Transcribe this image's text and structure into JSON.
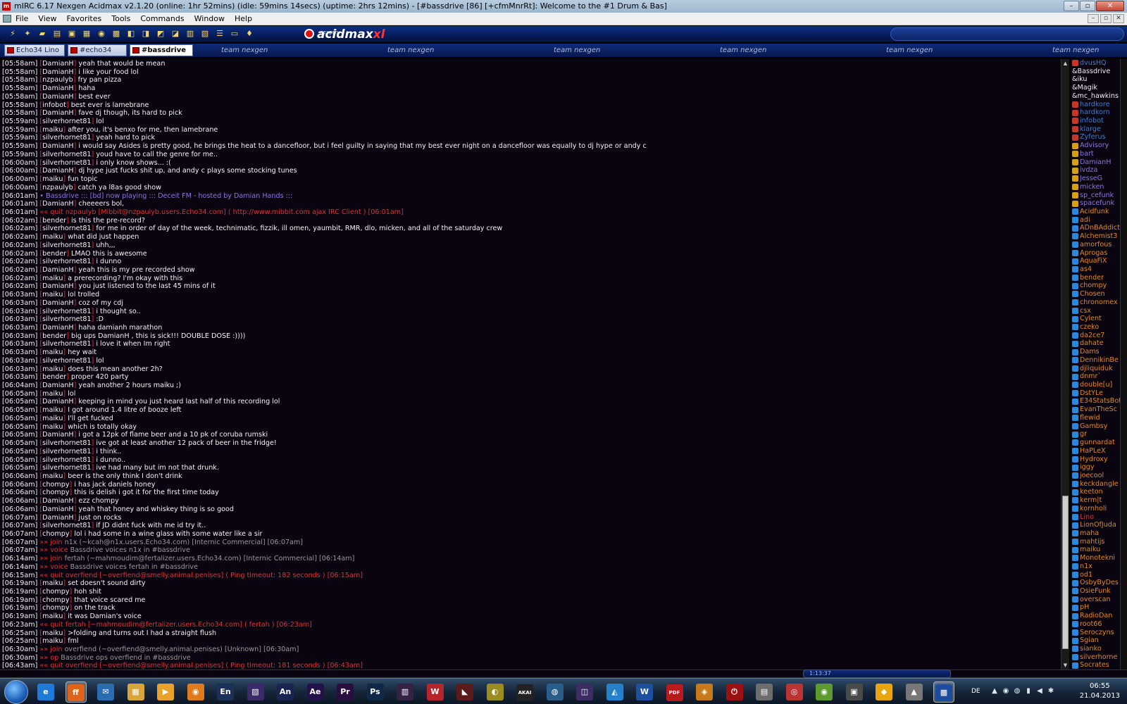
{
  "window": {
    "title": "mIRC 6.17 Nexgen Acidmax v2.1.20 (online: 1hr 52mins) (idle: 59mins 14secs) (uptime: 2hrs 12mins) - [#bassdrive [86] [+cfmMnrRt]: Welcome to the #1 Drum & Bas]",
    "controls": [
      "–",
      "▫",
      "✕"
    ]
  },
  "menu": [
    "File",
    "View",
    "Favorites",
    "Tools",
    "Commands",
    "Window",
    "Help"
  ],
  "mdi_controls": [
    "–",
    "▫",
    "✕"
  ],
  "toolbar": {
    "logo_small": "nexgen",
    "logo_main": "acidmax",
    "logo_suffix": "xl"
  },
  "switchbar": {
    "tabs": [
      "Echo34 Lino",
      "#echo34",
      "#bassdrive"
    ],
    "banner": "team nexgen"
  },
  "chat": [
    [
      "[05:58am]",
      "DamianH",
      "yeah that would be mean",
      "m"
    ],
    [
      "[05:58am]",
      "DamianH",
      "i like your food lol",
      "m"
    ],
    [
      "[05:58am]",
      "nzpaulyb",
      "fry pan pizza",
      "m"
    ],
    [
      "[05:58am]",
      "DamianH",
      "haha",
      "m"
    ],
    [
      "[05:58am]",
      "DamianH",
      "best ever",
      "m"
    ],
    [
      "[05:58am]",
      "infobot",
      "best ever is lamebrane",
      "m"
    ],
    [
      "[05:58am]",
      "DamianH",
      "fave dj though, its hard to pick",
      "m"
    ],
    [
      "[05:59am]",
      "silverhornet81",
      "lol",
      "m"
    ],
    [
      "[05:59am]",
      "maiku",
      "after you, it's benxo for me, then lamebrane",
      "m"
    ],
    [
      "[05:59am]",
      "silverhornet81",
      "yeah hard to pick",
      "m"
    ],
    [
      "[05:59am]",
      "DamianH",
      "i would say Asides is pretty good, he brings the heat to a dancefloor, but i feel guilty in saying that my best ever night on a dancefloor was equally to dj hype or andy c",
      "m"
    ],
    [
      "[05:59am]",
      "silverhornet81",
      "youd have to call the genre for me..",
      "m"
    ],
    [
      "[06:00am]",
      "silverhornet81",
      "i only know shows... :(",
      "m"
    ],
    [
      "[06:00am]",
      "DamianH",
      "dj hype just fucks shit up, and andy c plays some stocking tunes",
      "m"
    ],
    [
      "[06:00am]",
      "maiku",
      "fun topic",
      "m"
    ],
    [
      "[06:00am]",
      "nzpaulyb",
      "catch ya l8as good show",
      "m"
    ],
    [
      "[06:01am]",
      "",
      "• Bassdrive ::: [bd] now playing ::: Deceit FM - hosted by Damian Hands :::",
      "np"
    ],
    [
      "[06:01am]",
      "DamianH",
      "cheeeers bol,",
      "m"
    ],
    [
      "[06:01am]",
      "«« quit",
      "nzpaulyb [Mibbit@nzpaulyb.users.Echo34.com] ( http://www.mibbit.com ajax IRC Client )  [06:01am]",
      "quit"
    ],
    [
      "[06:02am]",
      "bender",
      "is this the pre-record?",
      "m"
    ],
    [
      "[06:02am]",
      "silverhornet81",
      "for me in order of day of the week, technimatic, fizzik, ill omen, yaumbit, RMR, dlo, micken, and all of the saturday crew",
      "m"
    ],
    [
      "[06:02am]",
      "maiku",
      "what did just happen",
      "m"
    ],
    [
      "[06:02am]",
      "silverhornet81",
      "uhh,,,",
      "m"
    ],
    [
      "[06:02am]",
      "bender",
      "LMAO this is awesome",
      "m"
    ],
    [
      "[06:02am]",
      "silverhornet81",
      "i dunno",
      "m"
    ],
    [
      "[06:02am]",
      "DamianH",
      "yeah this is my pre recorded show",
      "m"
    ],
    [
      "[06:02am]",
      "maiku",
      "a prerecording? I'm okay with this",
      "m"
    ],
    [
      "[06:02am]",
      "DamianH",
      "you just listened to the last 45 mins of it",
      "m"
    ],
    [
      "[06:03am]",
      "maiku",
      "lol trolled",
      "m"
    ],
    [
      "[06:03am]",
      "DamianH",
      "coz of my cdj",
      "m"
    ],
    [
      "[06:03am]",
      "silverhornet81",
      "i thought so..",
      "m"
    ],
    [
      "[06:03am]",
      "silverhornet81",
      ":D",
      "m"
    ],
    [
      "[06:03am]",
      "DamianH",
      "haha damianh marathon",
      "m"
    ],
    [
      "[06:03am]",
      "bender",
      "big ups DamianH , this is sick!!! DOUBLE DOSE :))))",
      "m"
    ],
    [
      "[06:03am]",
      "silverhornet81",
      "i love it when Im right",
      "m"
    ],
    [
      "[06:03am]",
      "maiku",
      "hey wait",
      "m"
    ],
    [
      "[06:03am]",
      "silverhornet81",
      "lol",
      "m"
    ],
    [
      "[06:03am]",
      "maiku",
      "does this mean another 2h?",
      "m"
    ],
    [
      "[06:03am]",
      "bender",
      "proper 420 party",
      "m"
    ],
    [
      "[06:04am]",
      "DamianH",
      "yeah another 2 hours maiku ;)",
      "m"
    ],
    [
      "[06:05am]",
      "maiku",
      "lol",
      "m"
    ],
    [
      "[06:05am]",
      "DamianH",
      "keeping in mind you just heard last half of this recording lol",
      "m"
    ],
    [
      "[06:05am]",
      "maiku",
      "I got around 1.4 litre of booze left",
      "m"
    ],
    [
      "[06:05am]",
      "maiku",
      "I'll get fucked",
      "m"
    ],
    [
      "[06:05am]",
      "maiku",
      "which is totally okay",
      "m"
    ],
    [
      "[06:05am]",
      "DamianH",
      "i got a 12pk of flame beer and a 10 pk of coruba rumski",
      "m"
    ],
    [
      "[06:05am]",
      "silverhornet81",
      "ive got at least another 12 pack of beer in the fridge!",
      "m"
    ],
    [
      "[06:05am]",
      "silverhornet81",
      "i think..",
      "m"
    ],
    [
      "[06:05am]",
      "silverhornet81",
      "i dunno..",
      "m"
    ],
    [
      "[06:05am]",
      "silverhornet81",
      "ive had many but im not that drunk.",
      "m"
    ],
    [
      "[06:06am]",
      "maiku",
      "beer is the only think I don't drink",
      "m"
    ],
    [
      "[06:06am]",
      "chompy",
      "i has jack daniels honey",
      "m"
    ],
    [
      "[06:06am]",
      "chompy",
      "this is delish i got it for the first time today",
      "m"
    ],
    [
      "[06:06am]",
      "DamianH",
      "ezz chompy",
      "m"
    ],
    [
      "[06:06am]",
      "DamianH",
      "yeah that honey and whiskey thing is so good",
      "m"
    ],
    [
      "[06:07am]",
      "DamianH",
      "just on rocks",
      "m"
    ],
    [
      "[06:07am]",
      "silverhornet81",
      "if JD didnt fuck with me id try it..",
      "m"
    ],
    [
      "[06:07am]",
      "chompy",
      "lol i had some in a wine glass with some water like a sir",
      "m"
    ],
    [
      "[06:07am]",
      "»» join",
      "n1x (~kcah@n1x.users.Echo34.com) [Internic Commercial] [06:07am]",
      "join"
    ],
    [
      "[06:07am]",
      "»» voice",
      "Bassdrive voices n1x in #bassdrive",
      "join"
    ],
    [
      "[06:14am]",
      "»» join",
      "fertah (~mahmoudim@fertalizer.users.Echo34.com) [Internic Commercial] [06:14am]",
      "join"
    ],
    [
      "[06:14am]",
      "»» voice",
      "Bassdrive voices fertah in #bassdrive",
      "join"
    ],
    [
      "[06:15am]",
      "«« quit",
      "overfiend [~overfiend@smelly.animal.penises] ( Ping timeout: 182 seconds )  [06:15am]",
      "quit"
    ],
    [
      "[06:19am]",
      "maiku",
      "set doesn't sound dirty",
      "m"
    ],
    [
      "[06:19am]",
      "chompy",
      "hoh shit",
      "m"
    ],
    [
      "[06:19am]",
      "chompy",
      "that voice scared me",
      "m"
    ],
    [
      "[06:19am]",
      "chompy",
      "on the track",
      "m"
    ],
    [
      "[06:19am]",
      "maiku",
      "it was Damian's voice",
      "m"
    ],
    [
      "[06:23am]",
      "«« quit",
      "fertah [~mahmoudim@fertalizer.users.Echo34.com] ( fertah )  [06:23am]",
      "quit"
    ],
    [
      "[06:25am]",
      "maiku",
      ">folding and turns out I had a straight flush",
      "m"
    ],
    [
      "[06:25am]",
      "maiku",
      "fml",
      "m"
    ],
    [
      "[06:30am]",
      "»» join",
      "overfiend (~overfiend@smelly.animal.penises) [Unknown] [06:30am]",
      "join"
    ],
    [
      "[06:30am]",
      "»» op",
      "Bassdrive ops overfiend in #bassdrive",
      "join"
    ],
    [
      "[06:43am]",
      "«« quit",
      "overfiend [~overfiend@smelly.animal.penises] ( Ping timeout: 181 seconds )  [06:43am]",
      "quit"
    ]
  ],
  "nicks": [
    [
      "dvusHQ",
      "#3f7fd6",
      "op"
    ],
    [
      "&Bassdrive",
      "#f0f0f0",
      "none"
    ],
    [
      "&iku",
      "#f0f0f0",
      "none"
    ],
    [
      "&Magik",
      "#f0f0f0",
      "none"
    ],
    [
      "&mc_hawkins",
      "#f0f0f0",
      "none"
    ],
    [
      "hardkore",
      "#3f7fd6",
      "op"
    ],
    [
      "hardkorn",
      "#3f7fd6",
      "op"
    ],
    [
      "infobot",
      "#3f7fd6",
      "op"
    ],
    [
      "klarge",
      "#3f7fd6",
      "op"
    ],
    [
      "Zyferus",
      "#3f7fd6",
      "op"
    ],
    [
      "Advisory",
      "#8a78e0",
      "halfop"
    ],
    [
      "bart",
      "#8a78e0",
      "halfop"
    ],
    [
      "DamianH",
      "#8a78e0",
      "halfop"
    ],
    [
      "ivdza",
      "#8a78e0",
      "halfop"
    ],
    [
      "JesseG",
      "#8a78e0",
      "halfop"
    ],
    [
      "micken",
      "#8a78e0",
      "halfop"
    ],
    [
      "sp_cefunk",
      "#8a78e0",
      "halfop"
    ],
    [
      "spacefunk",
      "#8a78e0",
      "halfop"
    ],
    [
      "Acidfunk",
      "#e38a1d",
      "voice"
    ],
    [
      "adi",
      "#e38a1d",
      "voice"
    ],
    [
      "ADnBAddict",
      "#e38a1d",
      "voice"
    ],
    [
      "Alchemist3",
      "#e38a1d",
      "voice"
    ],
    [
      "amorfous",
      "#e38a1d",
      "voice"
    ],
    [
      "Aprogas",
      "#e38a1d",
      "voice"
    ],
    [
      "AquaFiX",
      "#e38a1d",
      "voice"
    ],
    [
      "as4",
      "#e38a1d",
      "voice"
    ],
    [
      "bender",
      "#e38a1d",
      "voice"
    ],
    [
      "chompy",
      "#e38a1d",
      "voice"
    ],
    [
      "Chosen",
      "#e38a1d",
      "voice"
    ],
    [
      "chronomex",
      "#e38a1d",
      "voice"
    ],
    [
      "csx",
      "#e38a1d",
      "voice"
    ],
    [
      "Cylent",
      "#e38a1d",
      "voice"
    ],
    [
      "czeko",
      "#e38a1d",
      "voice"
    ],
    [
      "da2ce7",
      "#e38a1d",
      "voice"
    ],
    [
      "dahate",
      "#e38a1d",
      "voice"
    ],
    [
      "Dams",
      "#e38a1d",
      "voice"
    ],
    [
      "DennikinBe",
      "#e38a1d",
      "voice"
    ],
    [
      "djliquiduk",
      "#e38a1d",
      "voice"
    ],
    [
      "dnmr`",
      "#e38a1d",
      "voice"
    ],
    [
      "double[u]",
      "#e38a1d",
      "voice"
    ],
    [
      "DstYLe",
      "#e38a1d",
      "voice"
    ],
    [
      "E34StatsBot",
      "#e38a1d",
      "voice"
    ],
    [
      "EvanTheSc",
      "#e38a1d",
      "voice"
    ],
    [
      "flewid",
      "#e38a1d",
      "voice"
    ],
    [
      "Gambsy",
      "#e38a1d",
      "voice"
    ],
    [
      "gr",
      "#e38a1d",
      "voice"
    ],
    [
      "gunnardat",
      "#e38a1d",
      "voice"
    ],
    [
      "HaPLeX",
      "#e38a1d",
      "voice"
    ],
    [
      "Hydroxy",
      "#e38a1d",
      "voice"
    ],
    [
      "iggy",
      "#e38a1d",
      "voice"
    ],
    [
      "joecool",
      "#e38a1d",
      "voice"
    ],
    [
      "keckdangle",
      "#e38a1d",
      "voice"
    ],
    [
      "keeton",
      "#e38a1d",
      "voice"
    ],
    [
      "kerm|t",
      "#e38a1d",
      "voice"
    ],
    [
      "kornholi",
      "#e38a1d",
      "voice"
    ],
    [
      "Lino",
      "#e23030",
      "voice"
    ],
    [
      "LionOfJuda",
      "#e38a1d",
      "voice"
    ],
    [
      "maha",
      "#e38a1d",
      "voice"
    ],
    [
      "mahtijs",
      "#e38a1d",
      "voice"
    ],
    [
      "maiku",
      "#e38a1d",
      "voice"
    ],
    [
      "Monotekni",
      "#e38a1d",
      "voice"
    ],
    [
      "n1x",
      "#e38a1d",
      "voice"
    ],
    [
      "od1",
      "#e38a1d",
      "voice"
    ],
    [
      "OsbyByDes",
      "#e38a1d",
      "voice"
    ],
    [
      "OsieFunk",
      "#e38a1d",
      "voice"
    ],
    [
      "overscan",
      "#e38a1d",
      "voice"
    ],
    [
      "pH",
      "#e38a1d",
      "voice"
    ],
    [
      "RadioDan",
      "#e38a1d",
      "voice"
    ],
    [
      "root66",
      "#e38a1d",
      "voice"
    ],
    [
      "Seroczyns",
      "#e38a1d",
      "voice"
    ],
    [
      "Sgian",
      "#e38a1d",
      "voice"
    ],
    [
      "sianko",
      "#e38a1d",
      "voice"
    ],
    [
      "silverhorne",
      "#e38a1d",
      "voice"
    ],
    [
      "Socrates",
      "#e38a1d",
      "voice"
    ]
  ],
  "player": {
    "time": "1:13:37"
  },
  "taskbar": {
    "apps": [
      {
        "label": "e",
        "color": "#1e7ad6"
      },
      {
        "label": "ff",
        "color": "#e0631b",
        "active": true
      },
      {
        "label": "✉",
        "color": "#2b6bb0"
      },
      {
        "label": "▦",
        "color": "#d9a53a"
      },
      {
        "label": "▶",
        "color": "#e8a22c"
      },
      {
        "label": "◉",
        "color": "#e07b1c"
      },
      {
        "label": "En",
        "color": "#1c2f59"
      },
      {
        "label": "▧",
        "color": "#3a2a6a"
      },
      {
        "label": "An",
        "color": "#1a2450"
      },
      {
        "label": "Ae",
        "color": "#23124a"
      },
      {
        "label": "Pr",
        "color": "#2a0e40"
      },
      {
        "label": "Ps",
        "color": "#0f2847"
      },
      {
        "label": "▥",
        "color": "#324"
      },
      {
        "label": "W",
        "color": "#b8242b"
      },
      {
        "label": "◣",
        "color": "#5c1b1b"
      },
      {
        "label": "◐",
        "color": "#9a8c1f"
      },
      {
        "label": "AKAI",
        "color": "#222"
      },
      {
        "label": "◍",
        "color": "#2a5d8a"
      },
      {
        "label": "◫",
        "color": "#3b2c61"
      },
      {
        "label": "◭",
        "color": "#2680c9"
      },
      {
        "label": "W",
        "color": "#1e4fa0"
      },
      {
        "label": "PDF",
        "color": "#b81b1b"
      },
      {
        "label": "◈",
        "color": "#c77a19"
      },
      {
        "label": "⏻",
        "color": "#9b1010"
      },
      {
        "label": "▤",
        "color": "#6d6d6d"
      },
      {
        "label": "◎",
        "color": "#b33"
      },
      {
        "label": "◉",
        "color": "#5e9a2e"
      },
      {
        "label": "▣",
        "color": "#4a4a4a"
      },
      {
        "label": "◆",
        "color": "#e8a50f"
      },
      {
        "label": "▲",
        "color": "#777"
      },
      {
        "label": "▩",
        "color": "#1d4c9c",
        "active": true
      }
    ]
  },
  "tray": {
    "lang": "DE",
    "time": "06:55",
    "date": "21.04.2013"
  }
}
